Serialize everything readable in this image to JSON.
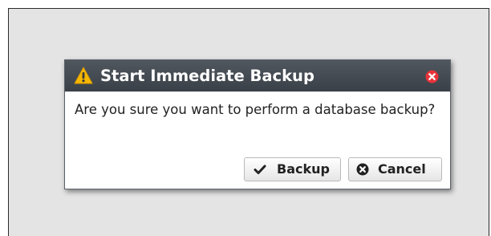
{
  "dialog": {
    "title": "Start Immediate Backup",
    "title_icon": "warning-triangle-icon",
    "close_icon": "close-icon",
    "message": "Are you sure you want to perform a database backup?"
  },
  "buttons": {
    "backup": {
      "label": "Backup",
      "icon": "checkmark-icon"
    },
    "cancel": {
      "label": "Cancel",
      "icon": "cancel-circle-icon"
    }
  },
  "colors": {
    "titlebar": "#3f454c",
    "warning": "#f5b700",
    "close": "#e8333a",
    "background": "#e4e4e4"
  }
}
